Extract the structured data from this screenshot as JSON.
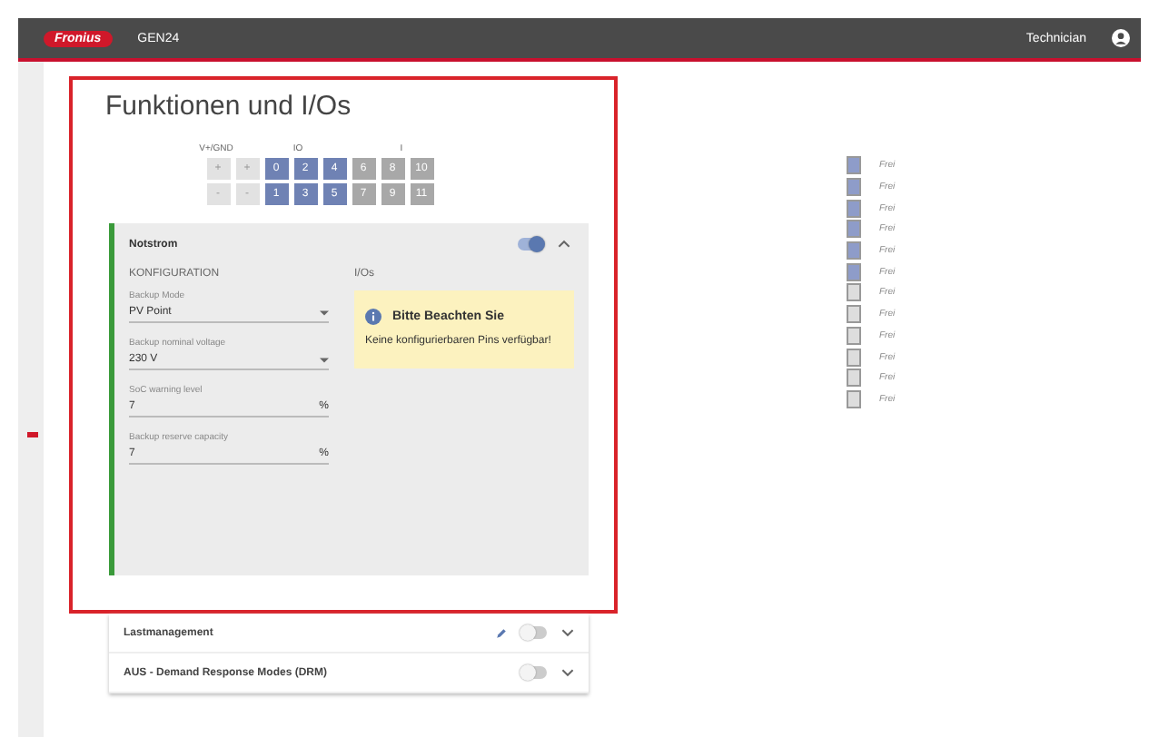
{
  "topbar": {
    "logo": "Fronius",
    "device": "GEN24",
    "user": "Technician"
  },
  "title": "Funktionen und I/Os",
  "pin_groups": [
    "V+/GND",
    "IO",
    "I"
  ],
  "pin_rows": [
    [
      {
        "label": "+",
        "kind": "power"
      },
      {
        "label": "+",
        "kind": "power"
      },
      {
        "label": "0",
        "kind": "io"
      },
      {
        "label": "2",
        "kind": "io"
      },
      {
        "label": "4",
        "kind": "io"
      },
      {
        "label": "6",
        "kind": "input"
      },
      {
        "label": "8",
        "kind": "input"
      },
      {
        "label": "10",
        "kind": "input"
      }
    ],
    [
      {
        "label": "-",
        "kind": "power"
      },
      {
        "label": "-",
        "kind": "power"
      },
      {
        "label": "1",
        "kind": "io"
      },
      {
        "label": "3",
        "kind": "io"
      },
      {
        "label": "5",
        "kind": "io"
      },
      {
        "label": "7",
        "kind": "input"
      },
      {
        "label": "9",
        "kind": "input"
      },
      {
        "label": "11",
        "kind": "input"
      }
    ]
  ],
  "expanded_section": {
    "title": "Notstrom",
    "on": true,
    "expanded": true,
    "config_heading": "KONFIGURATION",
    "io_heading": "I/Os",
    "fields": [
      {
        "label": "Backup Mode",
        "value": "PV Point",
        "kind": "select"
      },
      {
        "label": "Backup nominal voltage",
        "value": "230 V",
        "kind": "select"
      },
      {
        "label": "SoC warning level",
        "value": "7",
        "unit": "%",
        "kind": "number"
      },
      {
        "label": "Backup reserve capacity",
        "value": "7",
        "unit": "%",
        "kind": "number"
      }
    ],
    "notice": {
      "title": "Bitte Beachten Sie",
      "text": "Keine konfigurierbaren Pins verfügbar!"
    }
  },
  "sections": [
    {
      "title": "Lastmanagement",
      "on": false,
      "expanded": false,
      "editable": true
    },
    {
      "title": "AUS - Demand Response Modes (DRM)",
      "on": false,
      "expanded": false,
      "editable": false
    }
  ],
  "pin_list": [
    {
      "label": "Frei",
      "kind": "io"
    },
    {
      "label": "Frei",
      "kind": "io"
    },
    {
      "label": "Frei",
      "kind": "io"
    },
    {
      "label": "Frei",
      "kind": "io"
    },
    {
      "label": "Frei",
      "kind": "io"
    },
    {
      "label": "Frei",
      "kind": "io"
    },
    {
      "label": "Frei",
      "kind": "input"
    },
    {
      "label": "Frei",
      "kind": "input"
    },
    {
      "label": "Frei",
      "kind": "input"
    },
    {
      "label": "Frei",
      "kind": "input"
    },
    {
      "label": "Frei",
      "kind": "input"
    },
    {
      "label": "Frei",
      "kind": "input"
    }
  ]
}
